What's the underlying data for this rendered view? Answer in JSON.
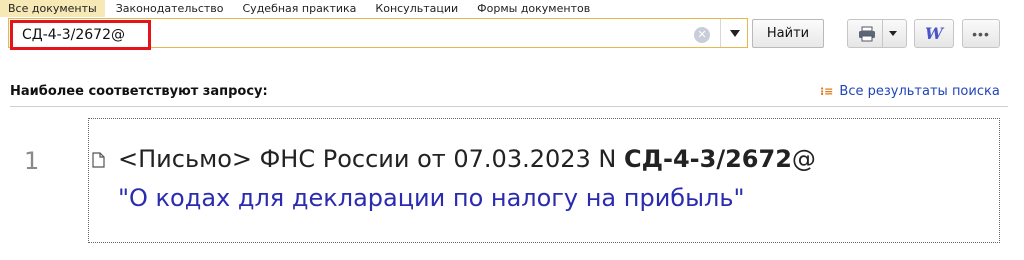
{
  "tabs": [
    {
      "label": "Все документы",
      "active": true
    },
    {
      "label": "Законодательство",
      "active": false
    },
    {
      "label": "Судебная практика",
      "active": false
    },
    {
      "label": "Консультации",
      "active": false
    },
    {
      "label": "Формы документов",
      "active": false
    }
  ],
  "search": {
    "value": "СД-4-3/2672@",
    "find_label": "Найти",
    "clear_glyph": "✕"
  },
  "toolbar": {
    "word_label": "W",
    "more_label": "•••"
  },
  "section": {
    "title": "Наиболее соответствуют запросу:",
    "all_results_label": "Все результаты поиска"
  },
  "result": {
    "number": "1",
    "line1_prefix": "<Письмо> ФНС России от 07.03.2023 N ",
    "line1_bold": "СД-4-3/2672",
    "line1_suffix": "@",
    "line2": "\"О кодах для декларации по налогу на прибыль\""
  },
  "colors": {
    "accent_border": "#e7b84e",
    "highlight_red": "#e5141b",
    "link_blue": "#2b2bb0",
    "active_tab_bg": "#f7e9b6"
  }
}
